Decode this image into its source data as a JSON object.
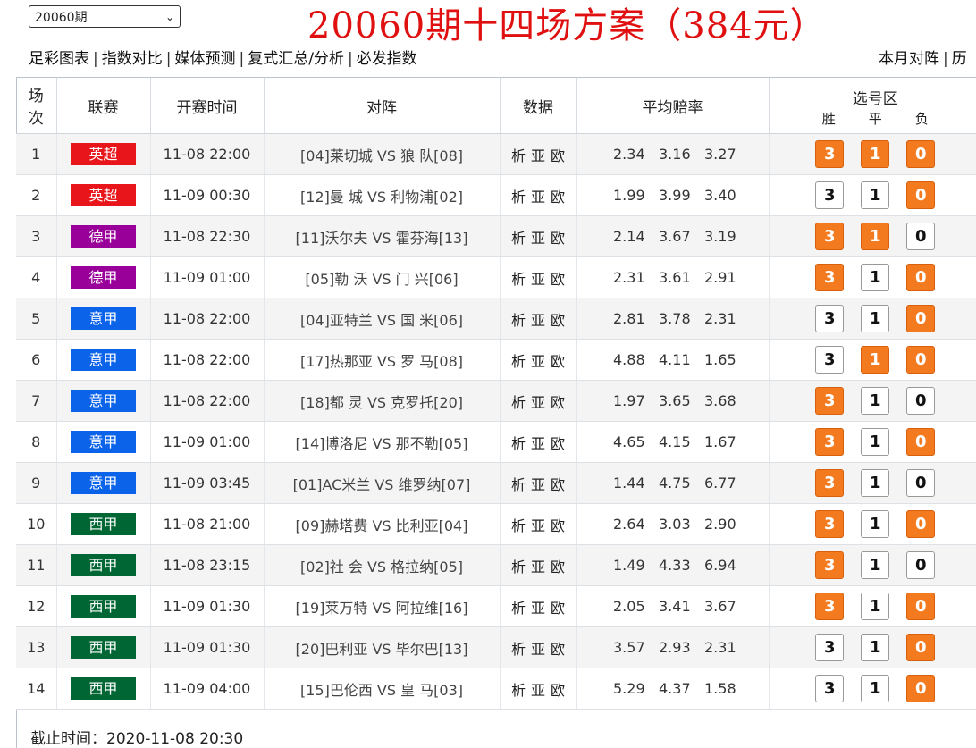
{
  "period_select": {
    "value": "20060期"
  },
  "title": "20060期十四场方案（384元）",
  "nav_links": [
    "足彩图表",
    "指数对比",
    "媒体预测",
    "复式汇总/分析",
    "必发指数"
  ],
  "nav_right": [
    "本月对阵",
    "历"
  ],
  "headers": {
    "no": [
      "场",
      "次"
    ],
    "league": "联赛",
    "time": "开赛时间",
    "match": "对阵",
    "data": "数据",
    "odds": "平均赔率",
    "select": "选号区",
    "win": "胜",
    "draw": "平",
    "lose": "负"
  },
  "data_links": [
    "析",
    "亚",
    "欧"
  ],
  "league_colors": {
    "英超": "#e8151b",
    "德甲": "#990099",
    "意甲": "#0b63ea",
    "西甲": "#006633"
  },
  "matches": [
    {
      "no": "1",
      "league": "英超",
      "time": "11-08 22:00",
      "match": "[04]莱切城 VS 狼 队[08]",
      "odds": [
        "2.34",
        "3.16",
        "3.27"
      ],
      "sel": [
        "3",
        "1",
        "0"
      ]
    },
    {
      "no": "2",
      "league": "英超",
      "time": "11-09 00:30",
      "match": "[12]曼 城 VS 利物浦[02]",
      "odds": [
        "1.99",
        "3.99",
        "3.40"
      ],
      "sel": [
        "0"
      ]
    },
    {
      "no": "3",
      "league": "德甲",
      "time": "11-08 22:30",
      "match": "[11]沃尔夫 VS 霍芬海[13]",
      "odds": [
        "2.14",
        "3.67",
        "3.19"
      ],
      "sel": [
        "3",
        "1"
      ]
    },
    {
      "no": "4",
      "league": "德甲",
      "time": "11-09 01:00",
      "match": "[05]勒 沃 VS 门 兴[06]",
      "odds": [
        "2.31",
        "3.61",
        "2.91"
      ],
      "sel": [
        "3",
        "0"
      ]
    },
    {
      "no": "5",
      "league": "意甲",
      "time": "11-08 22:00",
      "match": "[04]亚特兰 VS 国 米[06]",
      "odds": [
        "2.81",
        "3.78",
        "2.31"
      ],
      "sel": [
        "0"
      ]
    },
    {
      "no": "6",
      "league": "意甲",
      "time": "11-08 22:00",
      "match": "[17]热那亚 VS 罗 马[08]",
      "odds": [
        "4.88",
        "4.11",
        "1.65"
      ],
      "sel": [
        "1",
        "0"
      ]
    },
    {
      "no": "7",
      "league": "意甲",
      "time": "11-08 22:00",
      "match": "[18]都 灵 VS 克罗托[20]",
      "odds": [
        "1.97",
        "3.65",
        "3.68"
      ],
      "sel": [
        "3"
      ]
    },
    {
      "no": "8",
      "league": "意甲",
      "time": "11-09 01:00",
      "match": "[14]博洛尼 VS 那不勒[05]",
      "odds": [
        "4.65",
        "4.15",
        "1.67"
      ],
      "sel": [
        "3",
        "0"
      ]
    },
    {
      "no": "9",
      "league": "意甲",
      "time": "11-09 03:45",
      "match": "[01]AC米兰 VS 维罗纳[07]",
      "odds": [
        "1.44",
        "4.75",
        "6.77"
      ],
      "sel": [
        "3"
      ]
    },
    {
      "no": "10",
      "league": "西甲",
      "time": "11-08 21:00",
      "match": "[09]赫塔费 VS 比利亚[04]",
      "odds": [
        "2.64",
        "3.03",
        "2.90"
      ],
      "sel": [
        "3",
        "0"
      ]
    },
    {
      "no": "11",
      "league": "西甲",
      "time": "11-08 23:15",
      "match": "[02]社 会 VS 格拉纳[05]",
      "odds": [
        "1.49",
        "4.33",
        "6.94"
      ],
      "sel": [
        "3"
      ]
    },
    {
      "no": "12",
      "league": "西甲",
      "time": "11-09 01:30",
      "match": "[19]莱万特 VS 阿拉维[16]",
      "odds": [
        "2.05",
        "3.41",
        "3.67"
      ],
      "sel": [
        "3",
        "0"
      ]
    },
    {
      "no": "13",
      "league": "西甲",
      "time": "11-09 01:30",
      "match": "[20]巴利亚 VS 毕尔巴[13]",
      "odds": [
        "3.57",
        "2.93",
        "2.31"
      ],
      "sel": [
        "0"
      ]
    },
    {
      "no": "14",
      "league": "西甲",
      "time": "11-09 04:00",
      "match": "[15]巴伦西 VS 皇 马[03]",
      "odds": [
        "5.29",
        "4.37",
        "1.58"
      ],
      "sel": [
        "0"
      ]
    }
  ],
  "deadline": "截止时间：2020-11-08 20:30"
}
